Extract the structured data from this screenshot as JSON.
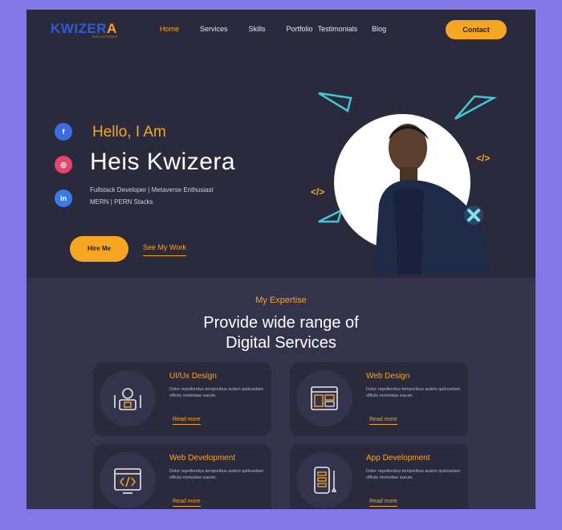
{
  "brand": {
    "name_main": "KWIZER",
    "name_accent": "A",
    "sub": "SOLUTIONS"
  },
  "nav": {
    "links": [
      "Home",
      "Services",
      "Skills",
      "Portfolio",
      "Testimonials",
      "Blog"
    ],
    "active": "Home",
    "contact_label": "Contact"
  },
  "social": {
    "facebook": "f",
    "dribbble": "◎",
    "linkedin": "in"
  },
  "hero": {
    "greeting": "Hello, I Am",
    "name": "Heis Kwizera",
    "tagline_line1": "Fullstack Developer | Metaverse Enthusiast",
    "tagline_line2": "MERN | PERN Stacks",
    "hire_label": "Hire Me",
    "work_label": "See My Work",
    "code_glyph": "</>"
  },
  "expertise": {
    "kicker": "My Expertise",
    "heading_line1": "Provide wide range of",
    "heading_line2": "Digital Services",
    "cards": [
      {
        "title": "UI/Ux Design",
        "desc": "Dolor repellendus temporibus autem quibusdam officiis molestiae earum.",
        "link": "Read more"
      },
      {
        "title": "Web Design",
        "desc": "Dolor repellendus temporibus autem quibusdam officiis molestiae earum.",
        "link": "Read more"
      },
      {
        "title": "Web Development",
        "desc": "Dolor repellendus temporibus autem quibusdam officiis molestiae earum.",
        "link": "Read more"
      },
      {
        "title": "App Development",
        "desc": "Dolor repellendus temporibus autem quibusdam officiis molestiae earum.",
        "link": "Read more"
      }
    ]
  },
  "colors": {
    "accent": "#f6a623",
    "background": "#2b2a3d",
    "section": "#34334b",
    "teal": "#3fc7d8",
    "page": "#8378e8"
  }
}
